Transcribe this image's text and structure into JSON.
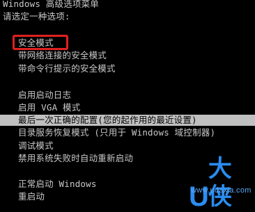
{
  "header": {
    "title": "Windows 高级选项菜单",
    "prompt": "请选定一种选项:"
  },
  "options": [
    {
      "label": "安全模式",
      "boxed": true
    },
    {
      "label": "带网络连接的安全模式"
    },
    {
      "label": "带命令行提示的安全模式"
    },
    {
      "label": "启用启动日志"
    },
    {
      "label": "启用 VGA 模式"
    },
    {
      "label": "最后一次正确的配置(您的起作用的最近设置)",
      "selected": true
    },
    {
      "label": "目录服务恢复模式 (只用于 Windows 域控制器)"
    },
    {
      "label": "调试模式"
    },
    {
      "label": "禁用系统失败时自动重新启动"
    },
    {
      "label": "正常启动 Windows"
    },
    {
      "label": "重启动"
    }
  ],
  "watermark": {
    "logo_letter": "U",
    "logo_text": "大侠",
    "url": "www.udaxia.com",
    "color": "#2a8cf0"
  },
  "colors": {
    "background": "#000000",
    "text": "#c8c8c8",
    "highlight_bg": "#c0c0c0",
    "box": "#e02020"
  }
}
